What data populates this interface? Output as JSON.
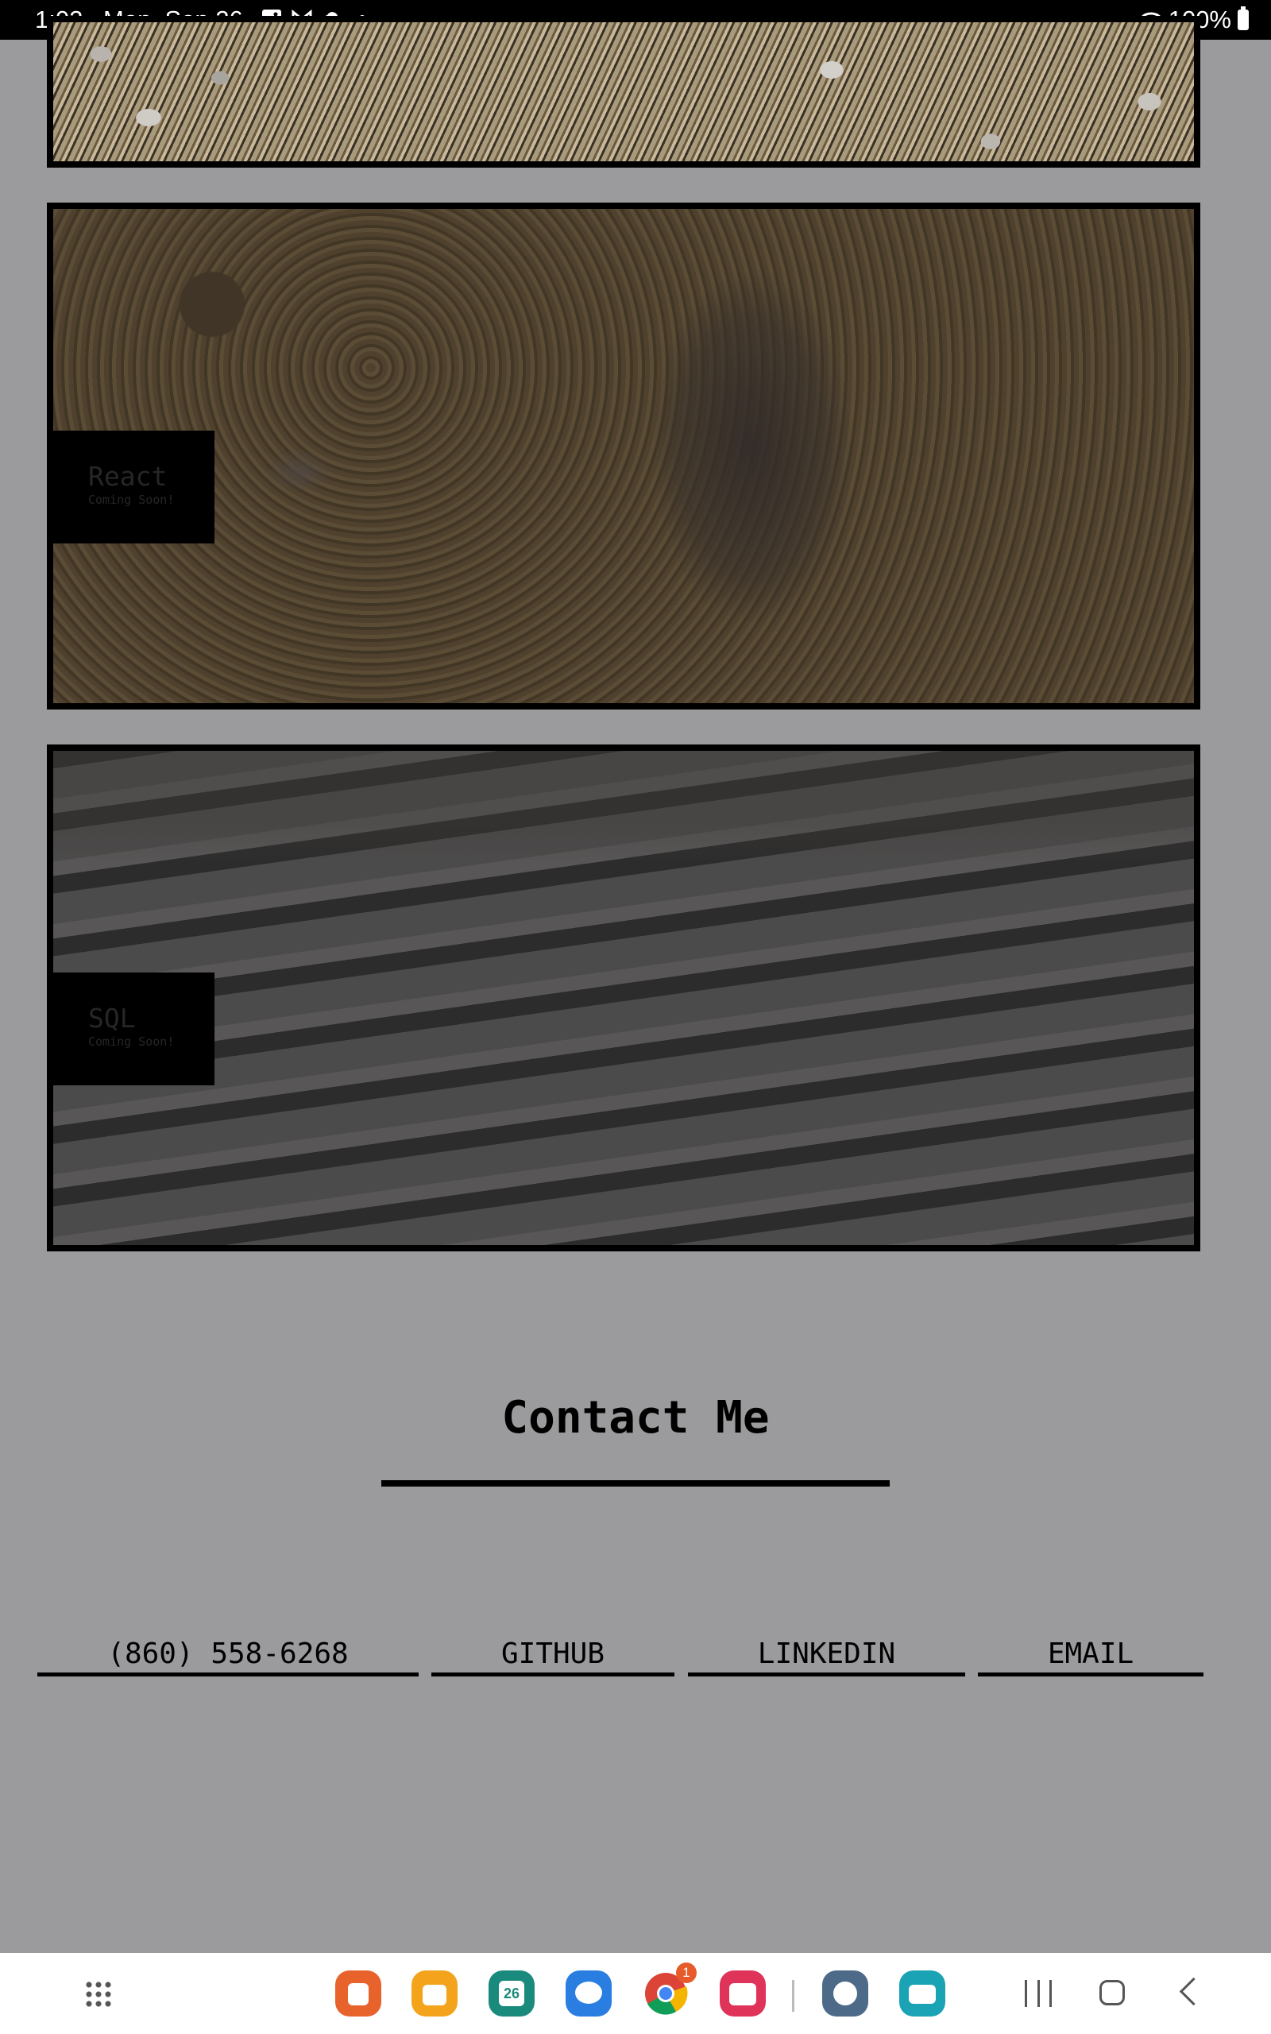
{
  "status_bar": {
    "time": "1:02",
    "date": "Mon, Sep 26",
    "battery": "100%",
    "icons": [
      "image-icon",
      "gmail-icon",
      "cloud-icon",
      "notification-dot-icon",
      "wifi-icon",
      "battery-icon"
    ]
  },
  "projects": [
    {
      "title": "",
      "subtitle": ""
    },
    {
      "title": "React",
      "subtitle": "Coming Soon!"
    },
    {
      "title": "SQL",
      "subtitle": "Coming Soon!"
    }
  ],
  "contact": {
    "heading": "Contact Me",
    "links": [
      {
        "label": "(860) 558-6268"
      },
      {
        "label": "GITHUB"
      },
      {
        "label": "LINKEDIN"
      },
      {
        "label": "EMAIL"
      }
    ]
  },
  "taskbar": {
    "apps": [
      {
        "name": "notes-app-icon",
        "color": "#e8622c"
      },
      {
        "name": "files-app-icon",
        "color": "#f3a41c"
      },
      {
        "name": "calendar-app-icon",
        "color": "#1a8a7c",
        "label": "26"
      },
      {
        "name": "messages-app-icon",
        "color": "#2a7de1"
      },
      {
        "name": "chrome-app-icon",
        "color": "#ffffff",
        "badge": "1"
      },
      {
        "name": "camera-app-icon",
        "color": "#e0335a"
      },
      {
        "name": "settings-app-icon",
        "color": "#4d6a88"
      },
      {
        "name": "keyboard-app-icon",
        "color": "#1aa3b5"
      }
    ]
  },
  "colors": {
    "page_background": "#9b9b9d",
    "card_border": "#000000",
    "label_box": "#000000"
  }
}
